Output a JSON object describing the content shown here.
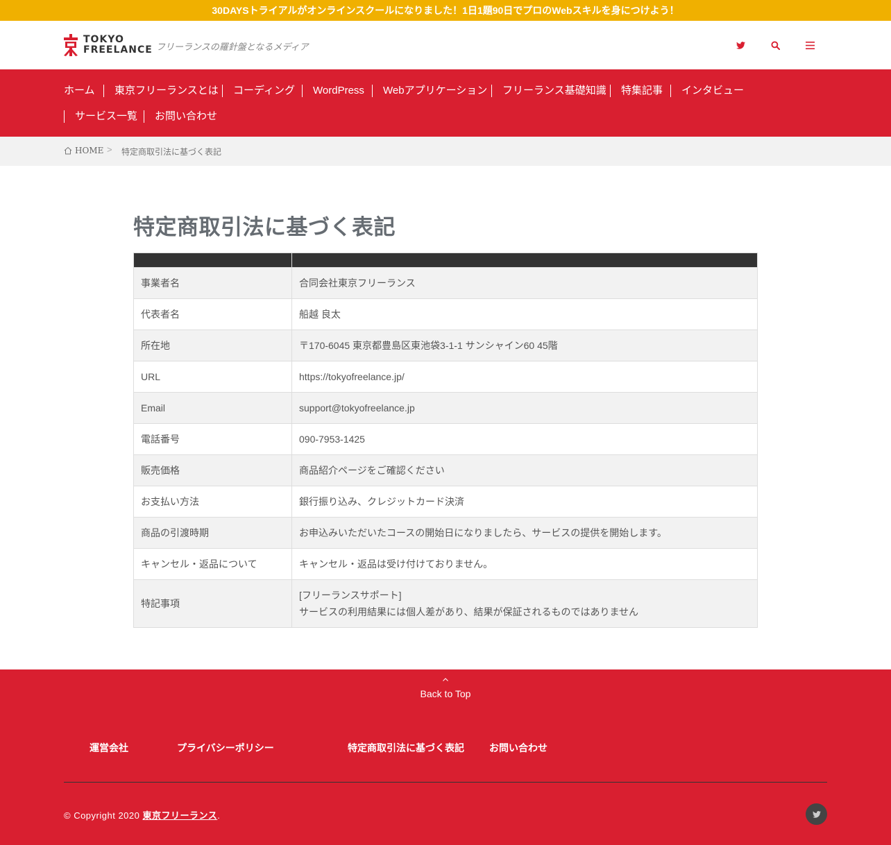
{
  "topbar": {
    "text": "30DAYSトライアルがオンラインスクールになりました！1日1題90日でプロのWebスキルを身につけよう！"
  },
  "header": {
    "logo_line1": "TOKYO",
    "logo_line2": "FREELANCE",
    "logo_mark_char": "東",
    "tagline": "フリーランスの羅針盤となるメディア",
    "icons": [
      "twitter-icon",
      "search-icon",
      "menu-icon"
    ]
  },
  "nav": {
    "items": [
      "ホーム",
      "東京フリーランスとは",
      "コーディング",
      "WordPress",
      "Webアプリケーション",
      "フリーランス基礎知識",
      "特集記事",
      "インタビュー",
      "サービス一覧",
      "お問い合わせ"
    ]
  },
  "breadcrumb": {
    "home": "HOME",
    "separator": ">",
    "current": "特定商取引法に基づく表記"
  },
  "main": {
    "title": "特定商取引法に基づく表記",
    "rows": [
      {
        "key": "事業者名",
        "value": "合同会社東京フリーランス"
      },
      {
        "key": "代表者名",
        "value": "船越 良太"
      },
      {
        "key": "所在地",
        "value": "〒170-6045 東京都豊島区東池袋3-1-1 サンシャイン60 45階"
      },
      {
        "key": "URL",
        "value": "https://tokyofreelance.jp/"
      },
      {
        "key": "Email",
        "value": "support@tokyofreelance.jp"
      },
      {
        "key": "電話番号",
        "value": "090-7953-1425"
      },
      {
        "key": "販売価格",
        "value": "商品紹介ページをご確認ください"
      },
      {
        "key": "お支払い方法",
        "value": "銀行振り込み、クレジットカード決済"
      },
      {
        "key": "商品の引渡時期",
        "value": "お申込みいただいたコースの開始日になりましたら、サービスの提供を開始します。"
      },
      {
        "key": "キャンセル・返品について",
        "value": "キャンセル・返品は受け付けておりません。"
      },
      {
        "key": "特記事項",
        "value": "[フリーランスサポート]",
        "value2": "サービスの利用結果には個人差があり、結果が保証されるものではありません"
      }
    ]
  },
  "footer": {
    "back_to_top": "Back to Top",
    "links": [
      "運営会社",
      "プライバシーポリシー",
      "特定商取引法に基づく表記",
      "お問い合わせ"
    ],
    "copyright_prefix": "© Copyright 2020 ",
    "copyright_link": "東京フリーランス",
    "copyright_suffix": "."
  },
  "colors": {
    "brand_red": "#d91f30",
    "topbar_yellow": "#f0b000",
    "table_header": "#333333"
  }
}
